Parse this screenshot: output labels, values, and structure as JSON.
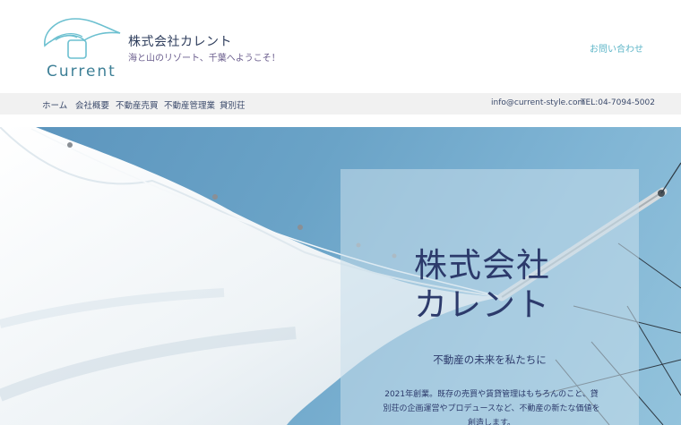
{
  "header": {
    "logo_text": "Current",
    "company_name": "株式会社カレント",
    "tagline": "海と山のリゾート、千葉へようこそ！",
    "contact_label": "お問い合わせ"
  },
  "nav": {
    "items": [
      {
        "label": "ホーム"
      },
      {
        "label": "会社概要"
      },
      {
        "label": "不動産売買"
      },
      {
        "label": "不動産管理業"
      },
      {
        "label": "貸別荘"
      }
    ],
    "email": "info@current-style.com",
    "tel": "TEL:04-7094-5002"
  },
  "hero": {
    "title_line1": "株式会社",
    "title_line2": "カレント",
    "subtitle": "不動産の未来を私たちに",
    "body": "2021年創業。既存の売買や賃貸管理はもちろんのこと、貸別荘の企画運営やプロデュースなど、不動産の新たな価値を創造します。"
  },
  "colors": {
    "brand_teal": "#5fb6c8",
    "title_navy": "#2c3a6b",
    "sky_blue": "#6aa3c7"
  }
}
